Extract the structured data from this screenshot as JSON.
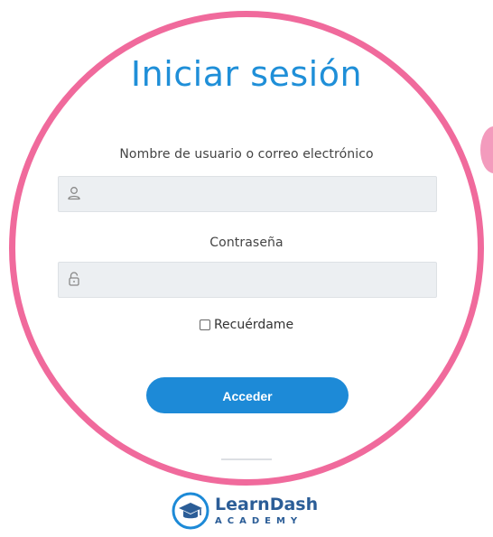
{
  "login": {
    "title": "Iniciar sesión",
    "username_label": "Nombre de usuario o correo electrónico",
    "username_value": "",
    "username_placeholder": "",
    "password_label": "Contraseña",
    "password_value": "",
    "password_placeholder": "",
    "remember_label": "Recuérdame",
    "remember_checked": false,
    "submit_label": "Acceder"
  },
  "brand": {
    "name": "LearnDash",
    "sub": "ACADEMY",
    "logo_icon": "graduation-cap-icon"
  },
  "icons": {
    "username": "user-icon",
    "password": "lock-icon"
  },
  "colors": {
    "accent": "#1f8fd8",
    "button": "#1d8ad7",
    "ring": "#f06a9c",
    "field_bg": "#eceff2",
    "brand": "#2b5d97"
  }
}
